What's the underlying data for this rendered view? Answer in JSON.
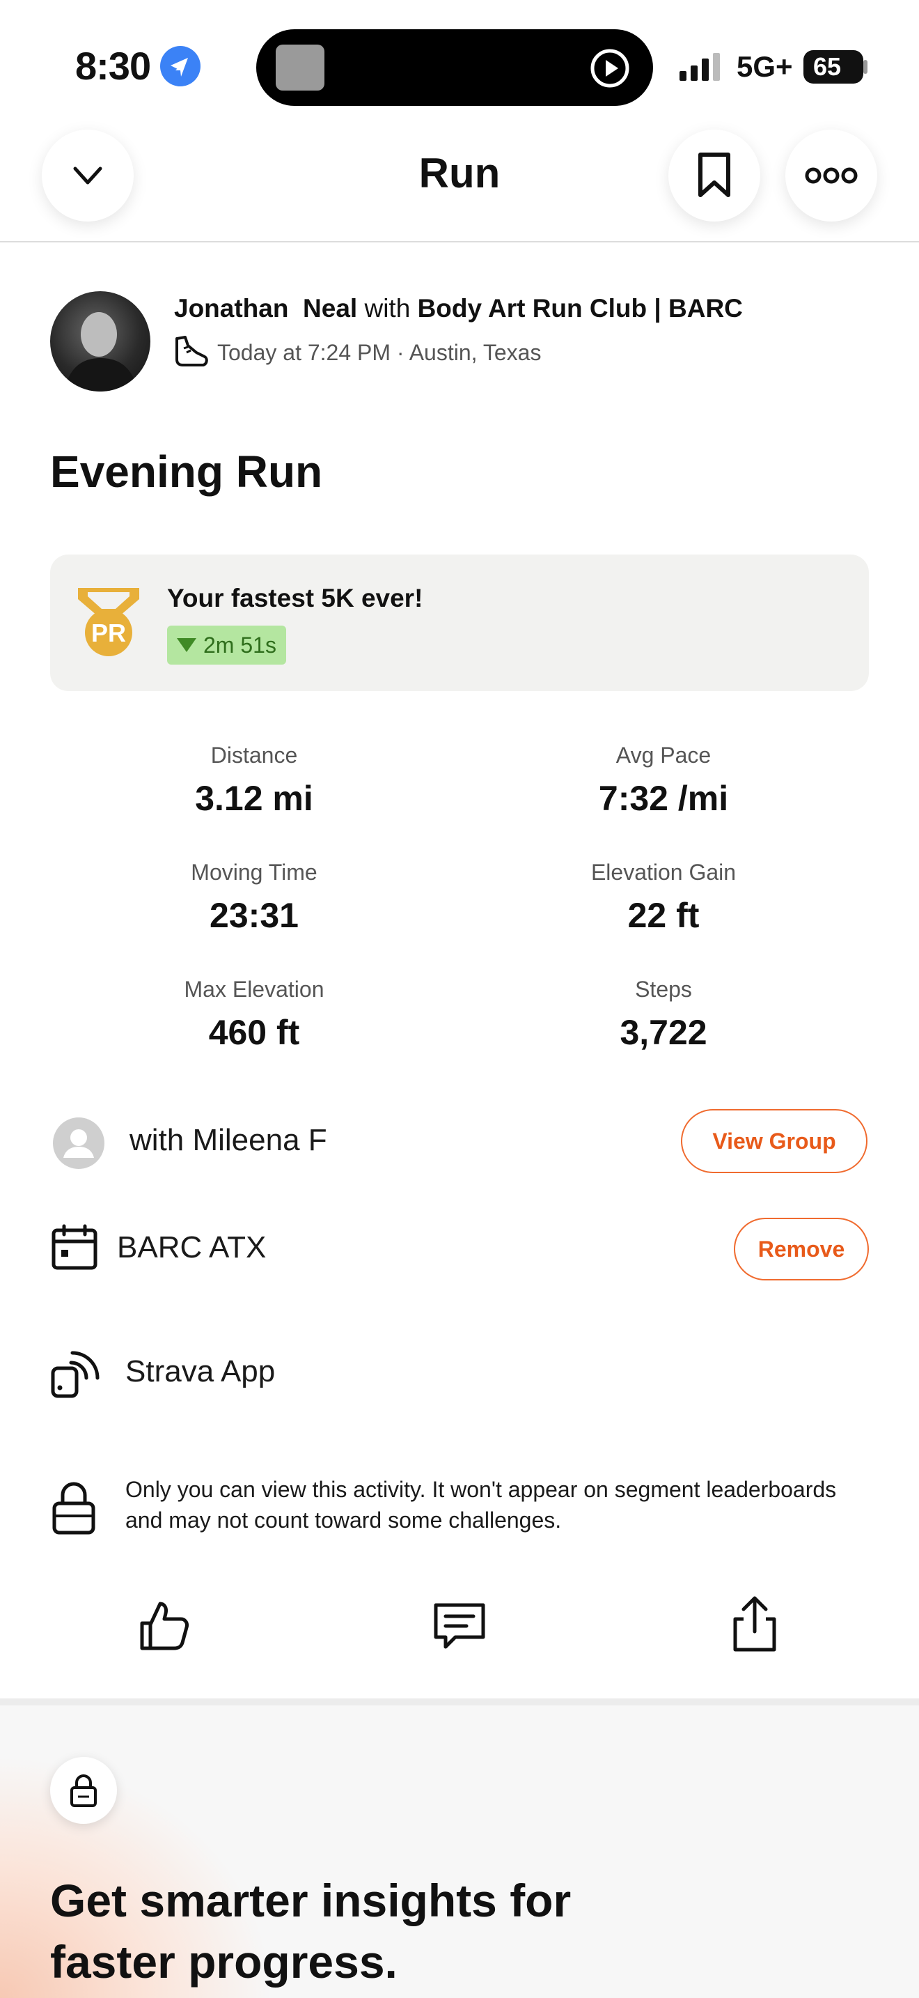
{
  "status_bar": {
    "time": "8:30",
    "network": "5G+",
    "battery": "65",
    "icons": [
      "location-arrow-icon",
      "music-thumbnail",
      "play-circle-icon",
      "signal-bars-icon",
      "battery-icon"
    ]
  },
  "header": {
    "title": "Run",
    "icons": [
      "chevron-down-icon",
      "bookmark-icon",
      "more-icon"
    ]
  },
  "athlete": {
    "name": "Jonathan  Neal",
    "with_word": "with",
    "club": "Body Art Run Club | BARC",
    "meta": "Today at 7:24 PM · Austin, Texas",
    "icon": "shoe-icon"
  },
  "activity": {
    "title": "Evening Run"
  },
  "pr": {
    "title": "Your fastest 5K ever!",
    "improvement": "2m 51s",
    "medal_text": "PR",
    "icon": "pr-medal-icon"
  },
  "stats": [
    {
      "label": "Distance",
      "value": "3.12 mi"
    },
    {
      "label": "Avg Pace",
      "value": "7:32 /mi"
    },
    {
      "label": "Moving Time",
      "value": "23:31"
    },
    {
      "label": "Elevation Gain",
      "value": "22 ft"
    },
    {
      "label": "Max Elevation",
      "value": "460 ft"
    },
    {
      "label": "Steps",
      "value": "3,722"
    }
  ],
  "group": {
    "text": "with Mileena F",
    "button": "View Group"
  },
  "event": {
    "text": "BARC ATX",
    "button": "Remove"
  },
  "device": {
    "text": "Strava App"
  },
  "privacy": {
    "text": "Only you can view this activity. It won't appear on segment leaderboards and may not count toward some challenges."
  },
  "actions": [
    "like-icon",
    "comment-icon",
    "share-icon"
  ],
  "promo": {
    "title": "Get smarter insights for faster progress."
  },
  "colors": {
    "accent": "#f06b2f",
    "pr_gold": "#e8b03a",
    "pr_badge_bg": "#b4e6a0",
    "location_blue": "#3b82f6"
  }
}
